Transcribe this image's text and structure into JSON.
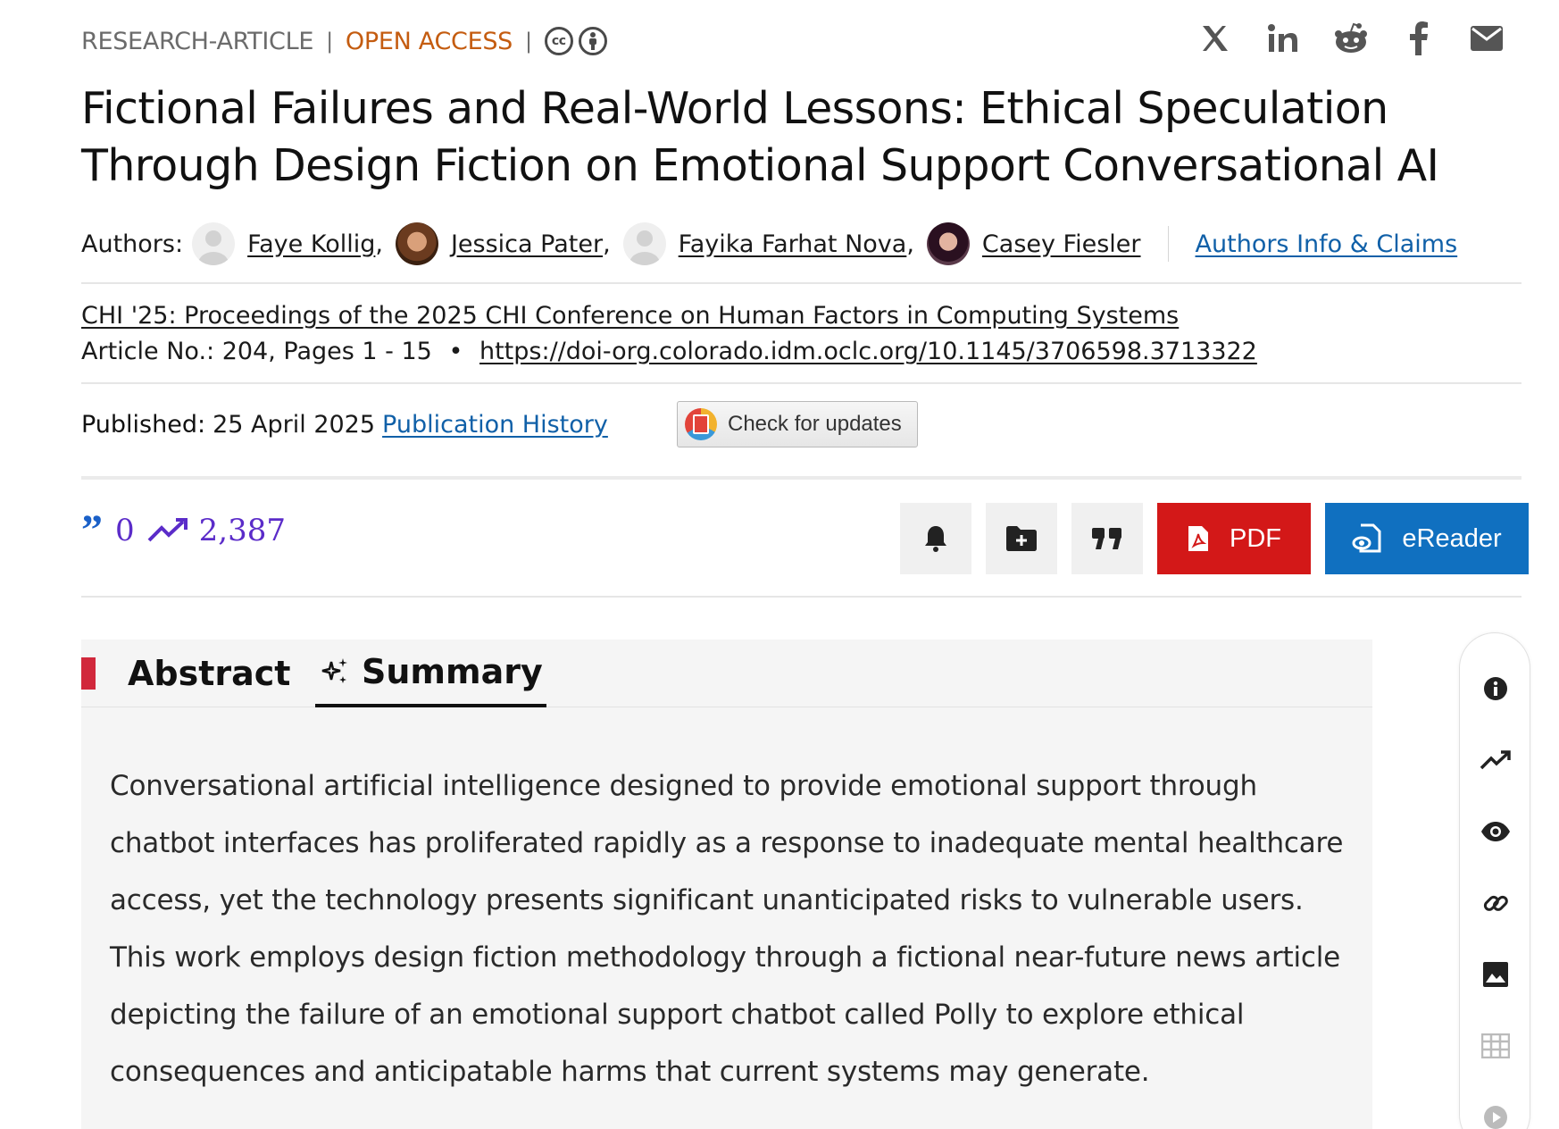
{
  "header": {
    "article_type": "RESEARCH-ARTICLE",
    "access": "OPEN ACCESS",
    "license_icons": [
      "cc-icon",
      "by-attribution-icon"
    ],
    "share_icons": [
      "x-icon",
      "linkedin-icon",
      "reddit-icon",
      "facebook-icon",
      "email-icon"
    ]
  },
  "title": "Fictional Failures and Real-World Lessons: Ethical Speculation Through Design Fiction on Emotional Support Conversational AI",
  "authors": {
    "label": "Authors:",
    "list": [
      {
        "name": "Faye Kollig"
      },
      {
        "name": "Jessica Pater"
      },
      {
        "name": "Fayika Farhat Nova"
      },
      {
        "name": "Casey Fiesler"
      }
    ],
    "info_link": "Authors Info & Claims"
  },
  "venue": {
    "proceedings": "CHI '25: Proceedings of the 2025 CHI Conference on Human Factors in Computing Systems",
    "article_pages": "Article No.: 204, Pages 1 - 15",
    "bullet": "•",
    "doi": "https://doi-org.colorado.idm.oclc.org/10.1145/3706598.3713322"
  },
  "published": {
    "label": "Published:",
    "date": "25 April 2025",
    "history_link": "Publication History",
    "check_updates": "Check for updates"
  },
  "metrics": {
    "citations": "0",
    "downloads": "2,387"
  },
  "actions": {
    "pdf": "PDF",
    "ereader": "eReader",
    "icons": [
      "bell-icon",
      "add-folder-icon",
      "quote-icon"
    ]
  },
  "tabs": {
    "abstract": "Abstract",
    "summary": "Summary",
    "active": "Summary"
  },
  "summary_text": "Conversational artificial intelligence designed to provide emotional support through chatbot interfaces has proliferated rapidly as a response to inadequate mental healthcare access, yet the technology presents significant unanticipated risks to vulnerable users. This work employs design fiction methodology through a fictional near-future news article depicting the failure of an emotional support chatbot called Polly to explore ethical consequences and anticipatable harms that current systems may generate.",
  "side_rail": [
    "info-icon",
    "trending-icon",
    "eye-icon",
    "link-icon",
    "image-icon",
    "table-icon",
    "play-icon"
  ],
  "colors": {
    "open_access": "#c45c10",
    "link": "#1060a8",
    "pdf": "#d31818",
    "ereader": "#1070c0",
    "metrics": "#5b2cc9",
    "abstract_marker": "#d1283c"
  }
}
